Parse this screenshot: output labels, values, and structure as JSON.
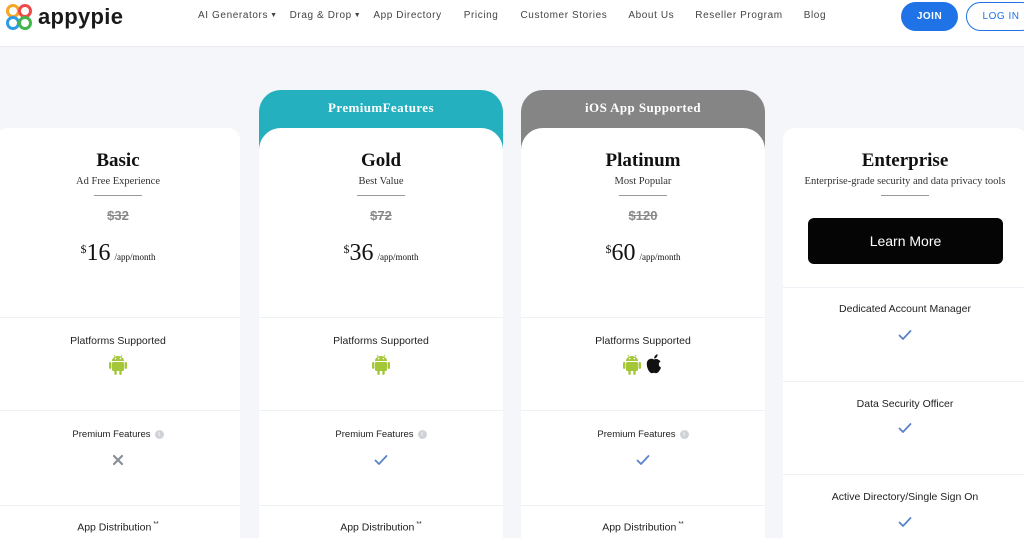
{
  "header": {
    "logo_text": "appypie",
    "nav": [
      {
        "label": "AI Generators",
        "dropdown": true
      },
      {
        "label": "Drag & Drop",
        "dropdown": true
      },
      {
        "label": "App Directory",
        "dropdown": false
      },
      {
        "label": "Pricing",
        "dropdown": false
      },
      {
        "label": "Customer Stories",
        "dropdown": false
      },
      {
        "label": "About Us",
        "dropdown": false
      },
      {
        "label": "Reseller Program",
        "dropdown": false
      },
      {
        "label": "Blog",
        "dropdown": false
      }
    ],
    "join_label": "JOIN",
    "login_label": "LOG IN"
  },
  "plans": {
    "basic": {
      "name": "Basic",
      "subtitle": "Ad Free Experience",
      "old_price": "$32",
      "currency": "$",
      "price": "16",
      "per": "/app/month",
      "platforms_label": "Platforms Supported",
      "premium_label": "Premium Features",
      "premium_included": false,
      "distribution_label": "App Distribution",
      "distribution_mark": "**"
    },
    "gold": {
      "tab_label": "PremiumFeatures",
      "name": "Gold",
      "subtitle": "Best Value",
      "old_price": "$72",
      "currency": "$",
      "price": "36",
      "per": "/app/month",
      "platforms_label": "Platforms Supported",
      "premium_label": "Premium Features",
      "premium_included": true,
      "distribution_label": "App Distribution",
      "distribution_mark": "**"
    },
    "platinum": {
      "tab_label": "iOS App Supported",
      "name": "Platinum",
      "subtitle": "Most Popular",
      "old_price": "$120",
      "currency": "$",
      "price": "60",
      "per": "/app/month",
      "platforms_label": "Platforms Supported",
      "premium_label": "Premium Features",
      "premium_included": true,
      "distribution_label": "App Distribution",
      "distribution_mark": "**"
    },
    "enterprise": {
      "name": "Enterprise",
      "subtitle": "Enterprise-grade security and data privacy tools",
      "cta_label": "Learn More",
      "features": [
        {
          "label": "Dedicated Account Manager",
          "included": true
        },
        {
          "label": "Data Security Officer",
          "included": true
        },
        {
          "label": "Active Directory/Single Sign On",
          "included": true
        }
      ]
    }
  },
  "colors": {
    "accent": "#1f73e6",
    "gold_tab": "#24b0be",
    "platinum_tab": "#858585",
    "android": "#a4c639",
    "check": "#5b84c6",
    "cross": "#8a8f96"
  }
}
